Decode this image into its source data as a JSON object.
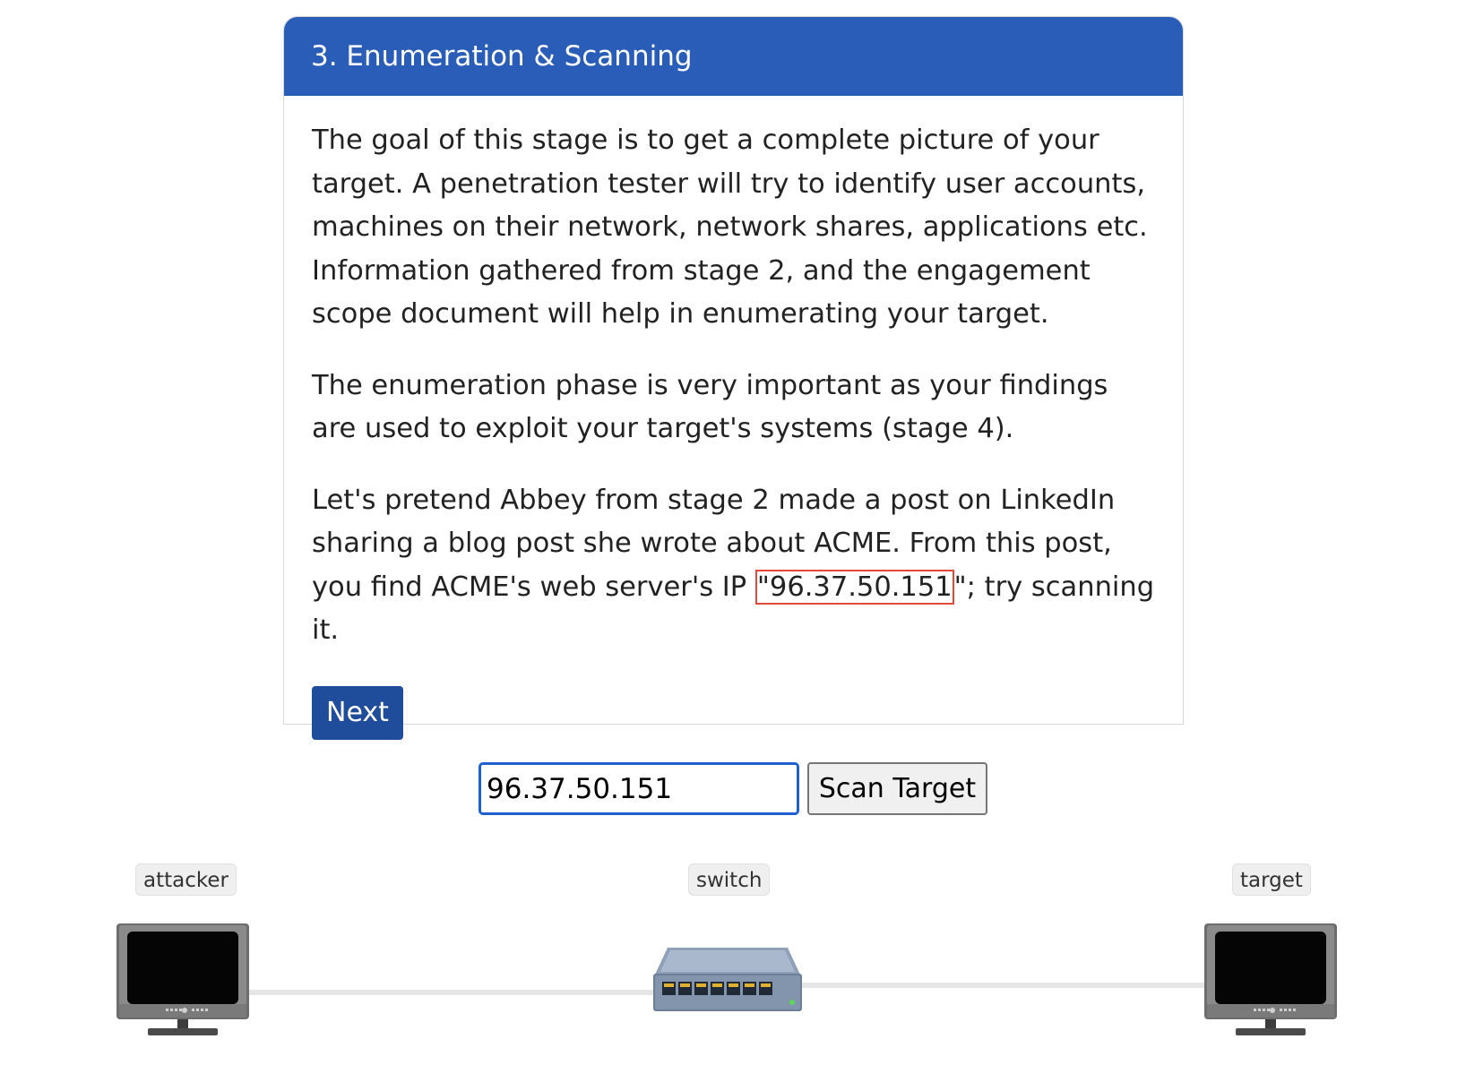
{
  "card": {
    "title": "3. Enumeration & Scanning",
    "paragraph1": "The goal of this stage is to get a complete picture of your target. A penetration tester will try to identify user accounts, machines on their network, network shares, applications etc. Information gathered from stage 2, and the engagement scope document will help in enumerating your target.",
    "paragraph2": "The enumeration phase is very important as your findings are used to exploit your target's systems (stage 4).",
    "paragraph3_before": "Let's pretend Abbey from stage 2 made a post on LinkedIn sharing a blog post she wrote about ACME. From this post, you find ACME's web server's IP ",
    "paragraph3_ip": "\"96.37.50.151",
    "paragraph3_after": "\"; try scanning it.",
    "next_label": "Next"
  },
  "scan": {
    "input_value": "96.37.50.151",
    "button_label": "Scan Target"
  },
  "network": {
    "attacker_label": "attacker",
    "switch_label": "switch",
    "target_label": "target"
  },
  "colors": {
    "header": "#2a5db8",
    "next_button": "#1f4c9b",
    "highlight_border": "#e8483b",
    "input_focus": "#1f5fd0"
  }
}
